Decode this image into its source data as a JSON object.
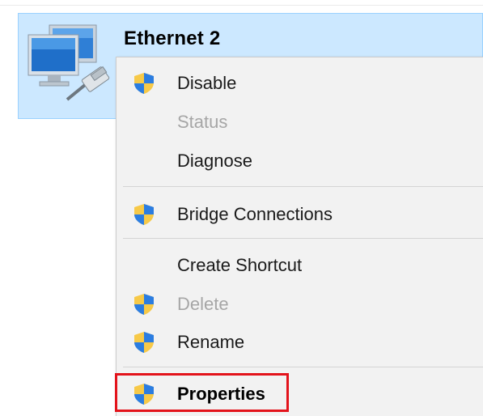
{
  "adapter": {
    "name": "Ethernet 2",
    "icon": "network-adapter-icon"
  },
  "context_menu": {
    "items": [
      {
        "label": "Disable",
        "icon": "uac-shield-icon",
        "enabled": true
      },
      {
        "label": "Status",
        "icon": null,
        "enabled": false
      },
      {
        "label": "Diagnose",
        "icon": null,
        "enabled": true
      },
      {
        "label": "Bridge Connections",
        "icon": "uac-shield-icon",
        "enabled": true
      },
      {
        "label": "Create Shortcut",
        "icon": null,
        "enabled": true
      },
      {
        "label": "Delete",
        "icon": "uac-shield-icon",
        "enabled": false
      },
      {
        "label": "Rename",
        "icon": "uac-shield-icon",
        "enabled": true
      },
      {
        "label": "Properties",
        "icon": "uac-shield-icon",
        "enabled": true,
        "emphasized": true
      }
    ]
  },
  "annotation": {
    "highlight_color": "#e3131b",
    "highlighted_item": "Properties"
  },
  "colors": {
    "tile_background": "#cce8ff",
    "tile_border": "#99d1ff",
    "menu_background": "#f2f2f2",
    "disabled_text": "#a6a6a6"
  }
}
